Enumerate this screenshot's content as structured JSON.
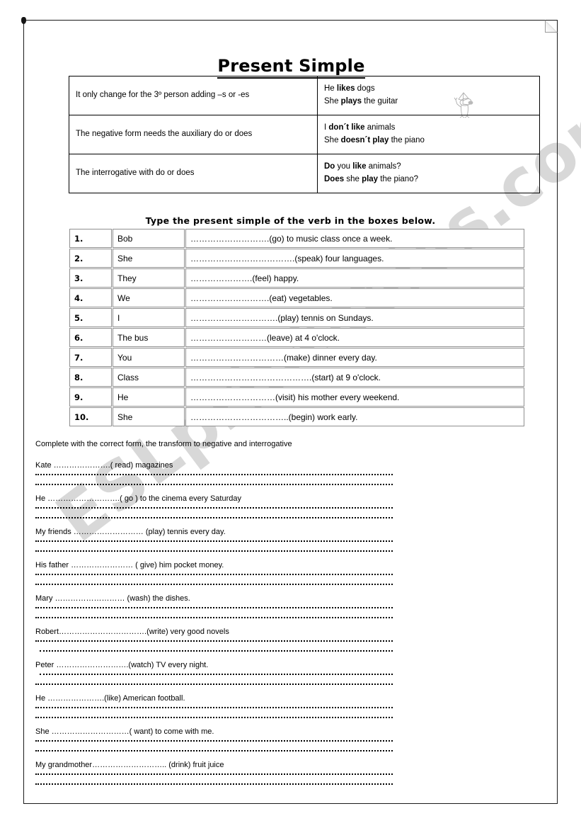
{
  "document": {
    "title": "Present Simple",
    "watermark": "ESLprintables.com"
  },
  "rules_table": {
    "rows": [
      {
        "rule": "It only change for the 3º person adding –s or -es",
        "examples": [
          {
            "pre": "He ",
            "bold": "likes",
            "post": " dogs"
          },
          {
            "pre": "She ",
            "bold": "plays",
            "post": " the guitar"
          }
        ]
      },
      {
        "rule": "The negative form  needs the auxiliary do or does",
        "examples": [
          {
            "pre": "I ",
            "bold": "don´t like",
            "post": " animals"
          },
          {
            "pre": "She ",
            "bold": "doesn´t play",
            "post": " the piano"
          }
        ]
      },
      {
        "rule": "The interrogative with do or does",
        "examples": [
          {
            "pre": "",
            "bold": "Do",
            "mid": " you ",
            "bold2": "like",
            "post": " animals?"
          },
          {
            "pre": "",
            "bold": "Does",
            "mid": " she ",
            "bold2": "play",
            "post": " the piano?"
          }
        ]
      }
    ]
  },
  "exercise1": {
    "heading": "Type the present simple of the verb in the boxes below.",
    "rows": [
      {
        "num": "1.",
        "subject": "Bob",
        "sentence": "……………………….(go) to music class once a week."
      },
      {
        "num": "2.",
        "subject": "She",
        "sentence": "……………………………….(speak) four languages."
      },
      {
        "num": "3.",
        "subject": "They",
        "sentence": "………………….(feel) happy."
      },
      {
        "num": "4.",
        "subject": "We",
        "sentence": "……………………….(eat) vegetables."
      },
      {
        "num": "5.",
        "subject": "I",
        "sentence": "………………………….(play) tennis on Sundays."
      },
      {
        "num": "6.",
        "subject": "The bus",
        "sentence": "………………………(leave) at 4 o'clock."
      },
      {
        "num": "7.",
        "subject": "You",
        "sentence": "……………………………(make) dinner every day."
      },
      {
        "num": "8.",
        "subject": "Class",
        "sentence": "…………………………………….(start) at 9 o'clock."
      },
      {
        "num": "9.",
        "subject": "He",
        "sentence": "…………………………(visit) his mother every weekend."
      },
      {
        "num": "10.",
        "subject": "She",
        "sentence": "……………………………..(begin) work early."
      }
    ]
  },
  "exercise2": {
    "heading": "Complete with the correct form, the transform to negative and interrogative",
    "items": [
      {
        "prompt": "Kate ………………….(  read) magazines"
      },
      {
        "prompt": "He ……………………….( go ) to the cinema every Saturday"
      },
      {
        "prompt": "My friends ……………………… (play) tennis every day."
      },
      {
        "prompt": "His father …………………… ( give) him pocket money."
      },
      {
        "prompt": "Mary ……………………… (wash) the dishes."
      },
      {
        "prompt": "Robert…………………………….(write) very good novels"
      },
      {
        "prompt": " Peter ……………………….(watch) TV every night."
      },
      {
        "prompt": "He ………………….(like) American football."
      },
      {
        "prompt": "She …………………………( want) to come with me."
      },
      {
        "prompt": "My grandmother……………………….. (drink) fruit juice"
      }
    ]
  }
}
